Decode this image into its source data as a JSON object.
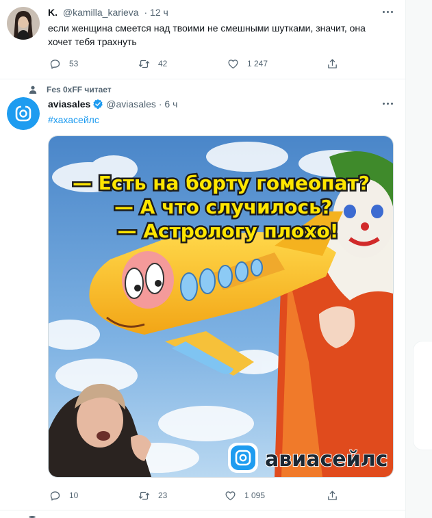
{
  "tweets": [
    {
      "name": "K.",
      "handle": "@kamilla_karieva",
      "time": "· 12 ч",
      "text": "если женщина смеется над твоими не смешными шутками, значит, она хочет тебя трахнуть",
      "replies": "53",
      "retweets": "42",
      "likes": "1 247"
    },
    {
      "context": "Fes 0xFF читает",
      "name": "aviasales",
      "handle": "@aviasales",
      "time": "· 6 ч",
      "hashtag": "#хахасейлс",
      "replies": "10",
      "retweets": "23",
      "likes": "1 095",
      "meme": {
        "line1": "— Есть на борту гомеопат?",
        "line2": "— А что случилось?",
        "line3": "— Астрологу плохо!",
        "brand": "авиасейлс"
      }
    }
  ],
  "icons": {
    "more": "more-horizontal-icon",
    "reply": "reply-icon",
    "retweet": "retweet-icon",
    "like": "heart-icon",
    "share": "share-icon",
    "follow": "person-icon",
    "verified": "verified-badge-icon"
  },
  "colors": {
    "accent": "#1d9bf0",
    "muted": "#536471",
    "text": "#0f1419",
    "border": "#eff3f4"
  }
}
